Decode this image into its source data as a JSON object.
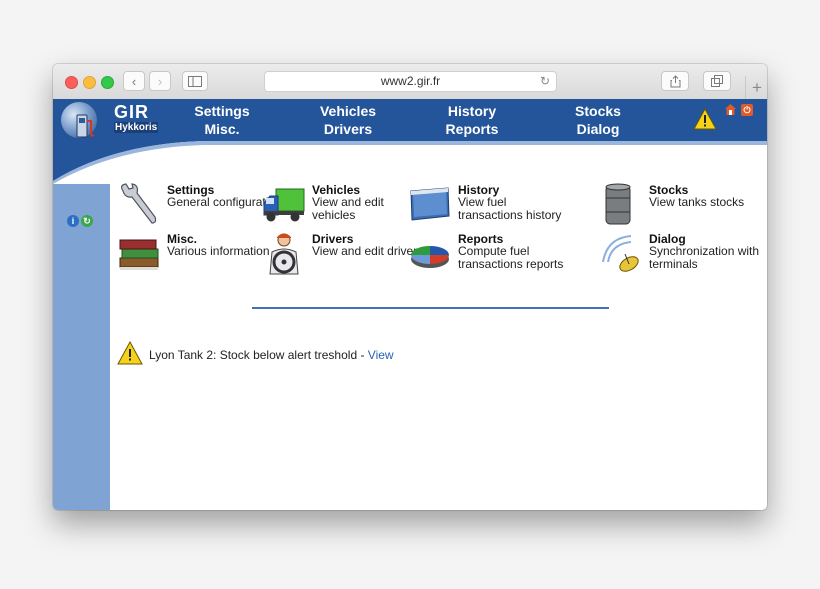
{
  "browser": {
    "url": "www2.gir.fr"
  },
  "brand": {
    "logo": "GIR",
    "subtitle": "Hykkoris"
  },
  "topmenu": [
    {
      "line1": "Settings",
      "line2": "Misc."
    },
    {
      "line1": "Vehicles",
      "line2": "Drivers"
    },
    {
      "line1": "History",
      "line2": "Reports"
    },
    {
      "line1": "Stocks",
      "line2": "Dialog"
    }
  ],
  "modules": [
    {
      "title": "Settings",
      "desc": "General configuration",
      "icon": "wrench-icon"
    },
    {
      "title": "Vehicles",
      "desc": "View and edit vehicles",
      "icon": "truck-icon"
    },
    {
      "title": "History",
      "desc": "View fuel transactions history",
      "icon": "history-card-icon"
    },
    {
      "title": "Stocks",
      "desc": "View tanks stocks",
      "icon": "barrel-icon"
    },
    {
      "title": "Misc.",
      "desc": "Various information",
      "icon": "books-icon"
    },
    {
      "title": "Drivers",
      "desc": "View and edit drivers",
      "icon": "driver-icon"
    },
    {
      "title": "Reports",
      "desc": "Compute fuel transactions reports",
      "icon": "pie-chart-icon"
    },
    {
      "title": "Dialog",
      "desc": "Synchronization with terminals",
      "icon": "satellite-dish-icon"
    }
  ],
  "alert": {
    "message": "Lyon Tank 2: Stock below alert treshold - ",
    "link": "View"
  },
  "colors": {
    "header_blue": "#24559a",
    "sidebar_blue": "#7fa3d3",
    "divider_blue": "#3f73b2",
    "link_blue": "#2a62b6"
  }
}
